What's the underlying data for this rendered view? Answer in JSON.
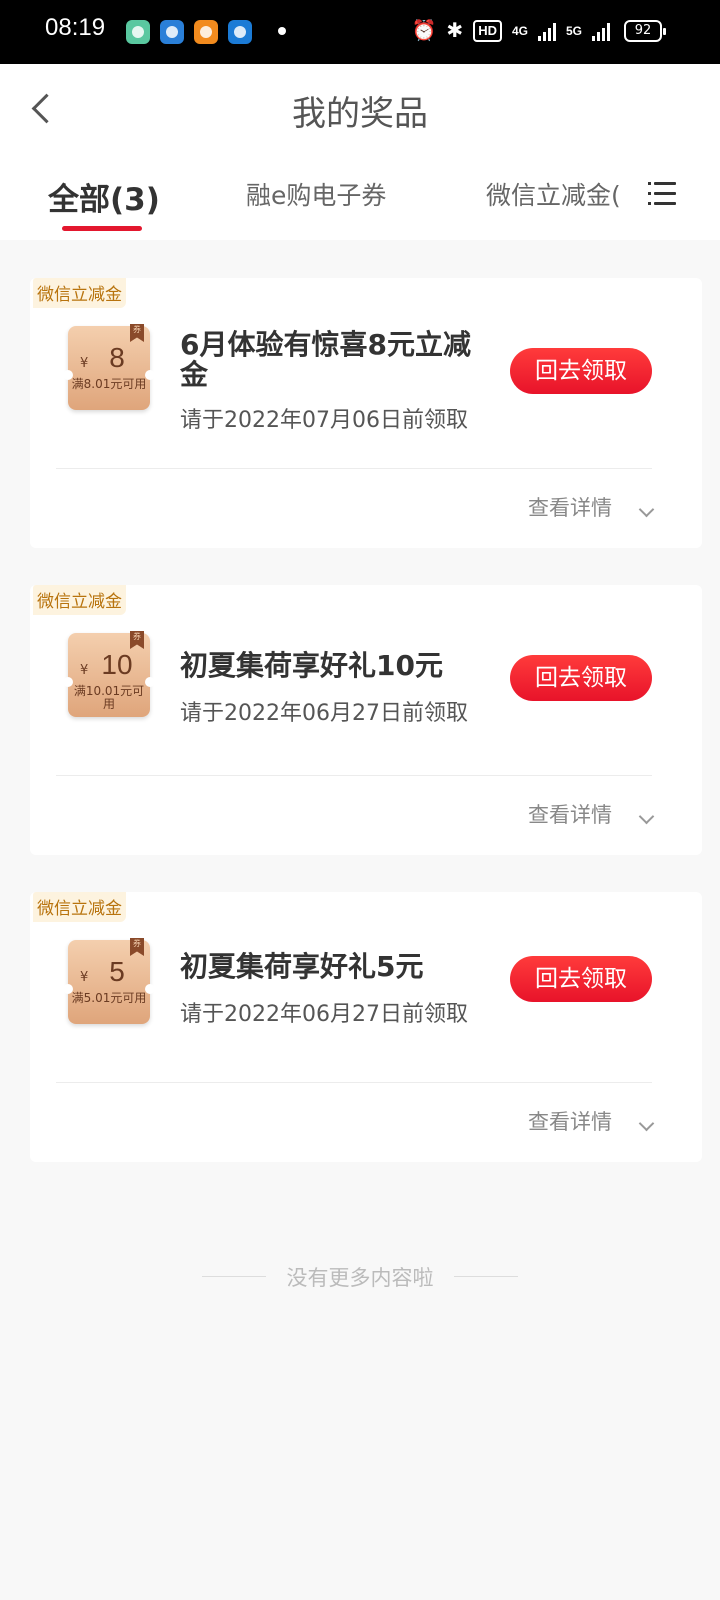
{
  "status_bar": {
    "time": "08:19",
    "hd": "HD",
    "net1": "4G",
    "net2": "5G",
    "battery": "92"
  },
  "header": {
    "title": "我的奖品"
  },
  "tabs": [
    {
      "label": "全部(3)",
      "active": true
    },
    {
      "label": "融e购电子券",
      "active": false
    },
    {
      "label": "微信立减金(",
      "active": false
    }
  ],
  "cards": [
    {
      "tag": "微信立减金",
      "coupon_yen": "¥",
      "coupon_amount": "8",
      "coupon_condition": "满8.01元可用",
      "coupon_ribbon": "券",
      "title": "6月体验有惊喜8元立减金",
      "date": "请于2022年07月06日前领取",
      "button": "回去领取",
      "details": "查看详情"
    },
    {
      "tag": "微信立减金",
      "coupon_yen": "¥",
      "coupon_amount": "10",
      "coupon_condition": "满10.01元可用",
      "coupon_ribbon": "券",
      "title": "初夏集荷享好礼10元",
      "date": "请于2022年06月27日前领取",
      "button": "回去领取",
      "details": "查看详情"
    },
    {
      "tag": "微信立减金",
      "coupon_yen": "¥",
      "coupon_amount": "5",
      "coupon_condition": "满5.01元可用",
      "coupon_ribbon": "券",
      "title": "初夏集荷享好礼5元",
      "date": "请于2022年06月27日前领取",
      "button": "回去领取",
      "details": "查看详情"
    }
  ],
  "footer": {
    "no_more": "没有更多内容啦"
  },
  "colors": {
    "accent_red": "#e3172e",
    "tag_text": "#b8730d",
    "coupon_gold": "#dfa57b"
  }
}
